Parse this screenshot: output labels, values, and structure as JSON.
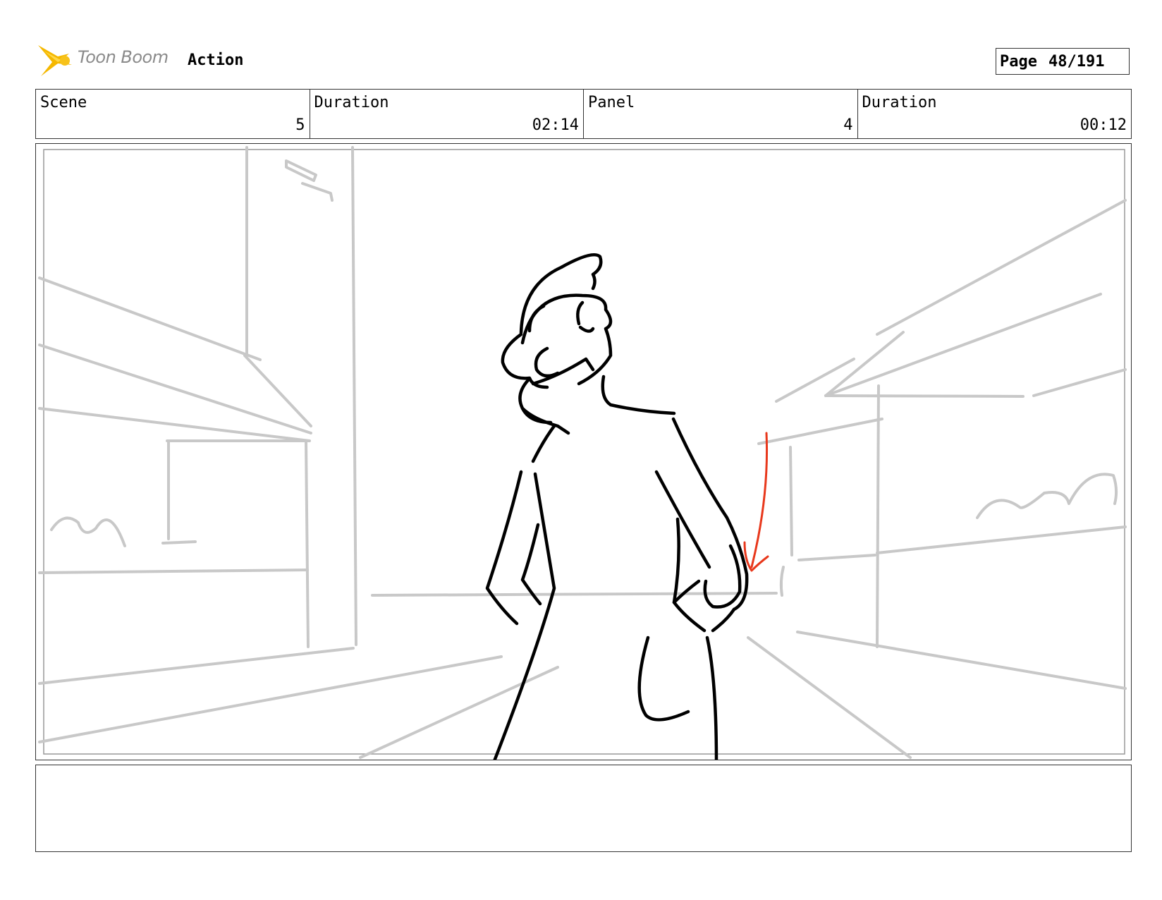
{
  "header": {
    "logo_text": "Toon Boom",
    "board_type": "Action",
    "page_label": "Page",
    "page_number": "48/191"
  },
  "info": {
    "scene_label": "Scene",
    "scene_value": "5",
    "scene_duration_label": "Duration",
    "scene_duration_value": "02:14",
    "panel_label": "Panel",
    "panel_value": "4",
    "panel_duration_label": "Duration",
    "panel_duration_value": "00:12"
  },
  "panel": {
    "colors": {
      "background_lines": "#c8c8c8",
      "character_lines": "#000000",
      "motion_arrow": "#e8381c",
      "logo_accent": "#f5b800"
    }
  },
  "caption": {
    "text": ""
  }
}
